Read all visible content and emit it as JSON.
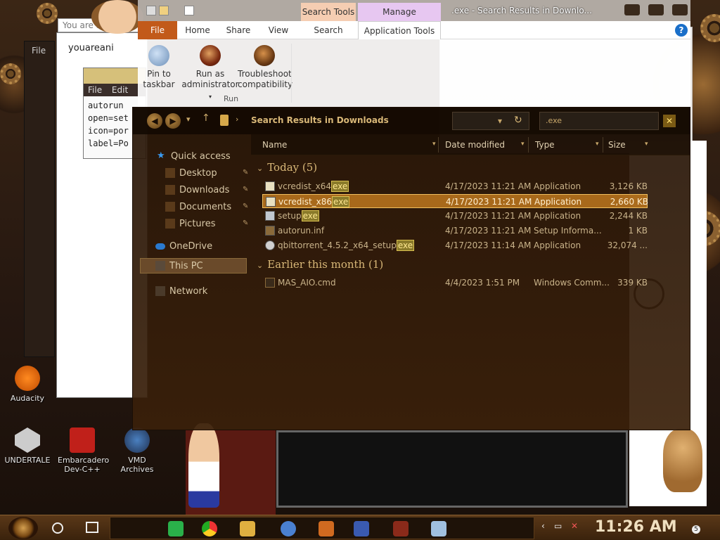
{
  "window": {
    "title": ".exe - Search Results in Downlo...",
    "context_tabs": {
      "search_tools": "Search Tools",
      "manage": "Manage"
    },
    "tabs": {
      "file": "File",
      "home": "Home",
      "share": "Share",
      "view": "View",
      "search": "Search",
      "application_tools": "Application Tools"
    },
    "help_label": "?"
  },
  "ribbon": {
    "pin_line1": "Pin to",
    "pin_line2": "taskbar",
    "admin_line1": "Run as",
    "admin_line2": "administrator",
    "trouble_line1": "Troubleshoot",
    "trouble_line2": "compatibility",
    "group_run": "Run"
  },
  "address": {
    "breadcrumb": "Search Results in Downloads",
    "search_value": ".exe",
    "close_label": "✕"
  },
  "nav": {
    "quick_access": "Quick access",
    "desktop": "Desktop",
    "downloads": "Downloads",
    "documents": "Documents",
    "pictures": "Pictures",
    "onedrive": "OneDrive",
    "this_pc": "This PC",
    "network": "Network"
  },
  "columns": {
    "name": "Name",
    "date_modified": "Date modified",
    "type": "Type",
    "size": "Size"
  },
  "groups": {
    "today": "Today (5)",
    "earlier": "Earlier this month (1)"
  },
  "files": [
    {
      "base": "vcredist_x64",
      "ext": "exe",
      "date": "4/17/2023 11:21 AM",
      "type": "Application",
      "size": "3,126 KB"
    },
    {
      "base": "vcredist_x86",
      "ext": "exe",
      "date": "4/17/2023 11:21 AM",
      "type": "Application",
      "size": "2,660 KB"
    },
    {
      "base": "setup",
      "ext": "exe",
      "date": "4/17/2023 11:21 AM",
      "type": "Application",
      "size": "2,244 KB"
    },
    {
      "base": "autorun.inf",
      "ext": "",
      "date": "4/17/2023 11:21 AM",
      "type": "Setup Informa...",
      "size": "1 KB"
    },
    {
      "base": "qbittorrent_4.5.2_x64_setup",
      "ext": "exe",
      "date": "4/17/2023 11:14 AM",
      "type": "Application",
      "size": "32,074 ..."
    },
    {
      "base": "MAS_AIO.cmd",
      "ext": "",
      "date": "4/4/2023 1:51 PM",
      "type": "Windows Comm...",
      "size": "339 KB"
    }
  ],
  "background": {
    "search_placeholder": "You are a",
    "doc_text": "youareani",
    "notepad_menu_file": "File",
    "notepad_menu_edit": "Edit",
    "notepad_lines": "autorun\nopen=set\nicon=por\nlabel=Po",
    "left_file": "File"
  },
  "desktop_icons": {
    "audacity": "Audacity",
    "undertale": "UNDERTALE",
    "embarcadero": "Embarcadero Dev-C++",
    "vmd": "VMD Archives"
  },
  "taskbar": {
    "time": "11:26 AM",
    "notifications": "5"
  },
  "colors": {
    "file_tab": "#c25a1a",
    "selection": "#be781e",
    "explorer_bg": "#2a1608",
    "accent_text": "#d9b878"
  }
}
